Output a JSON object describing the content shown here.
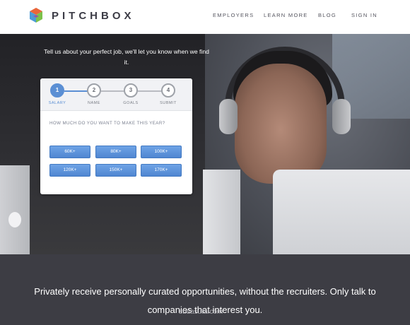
{
  "header": {
    "logo_text": "PITCHBOX",
    "nav": [
      "EMPLOYERS",
      "LEARN MORE",
      "BLOG",
      "SIGN IN"
    ]
  },
  "hero": {
    "tagline": "Tell us about your perfect job, we'll let you know when we find it."
  },
  "form": {
    "steps": [
      {
        "number": "1",
        "label": "SALARY"
      },
      {
        "number": "2",
        "label": "NAME"
      },
      {
        "number": "3",
        "label": "GOALS"
      },
      {
        "number": "4",
        "label": "SUBMIT"
      }
    ],
    "active_step": 1,
    "question": "HOW MUCH DO YOU WANT TO MAKE THIS YEAR?",
    "options": [
      "60K+",
      "80K+",
      "100K+",
      "120K+",
      "150K+",
      "170K+"
    ]
  },
  "footer": {
    "text": "Privately receive personally curated opportunities, without the recruiters. Only talk to companies that interest you.",
    "watermark": "sudasuta.com"
  },
  "colors": {
    "accent": "#5b8fd4",
    "dark_band": "#3d3d44"
  }
}
